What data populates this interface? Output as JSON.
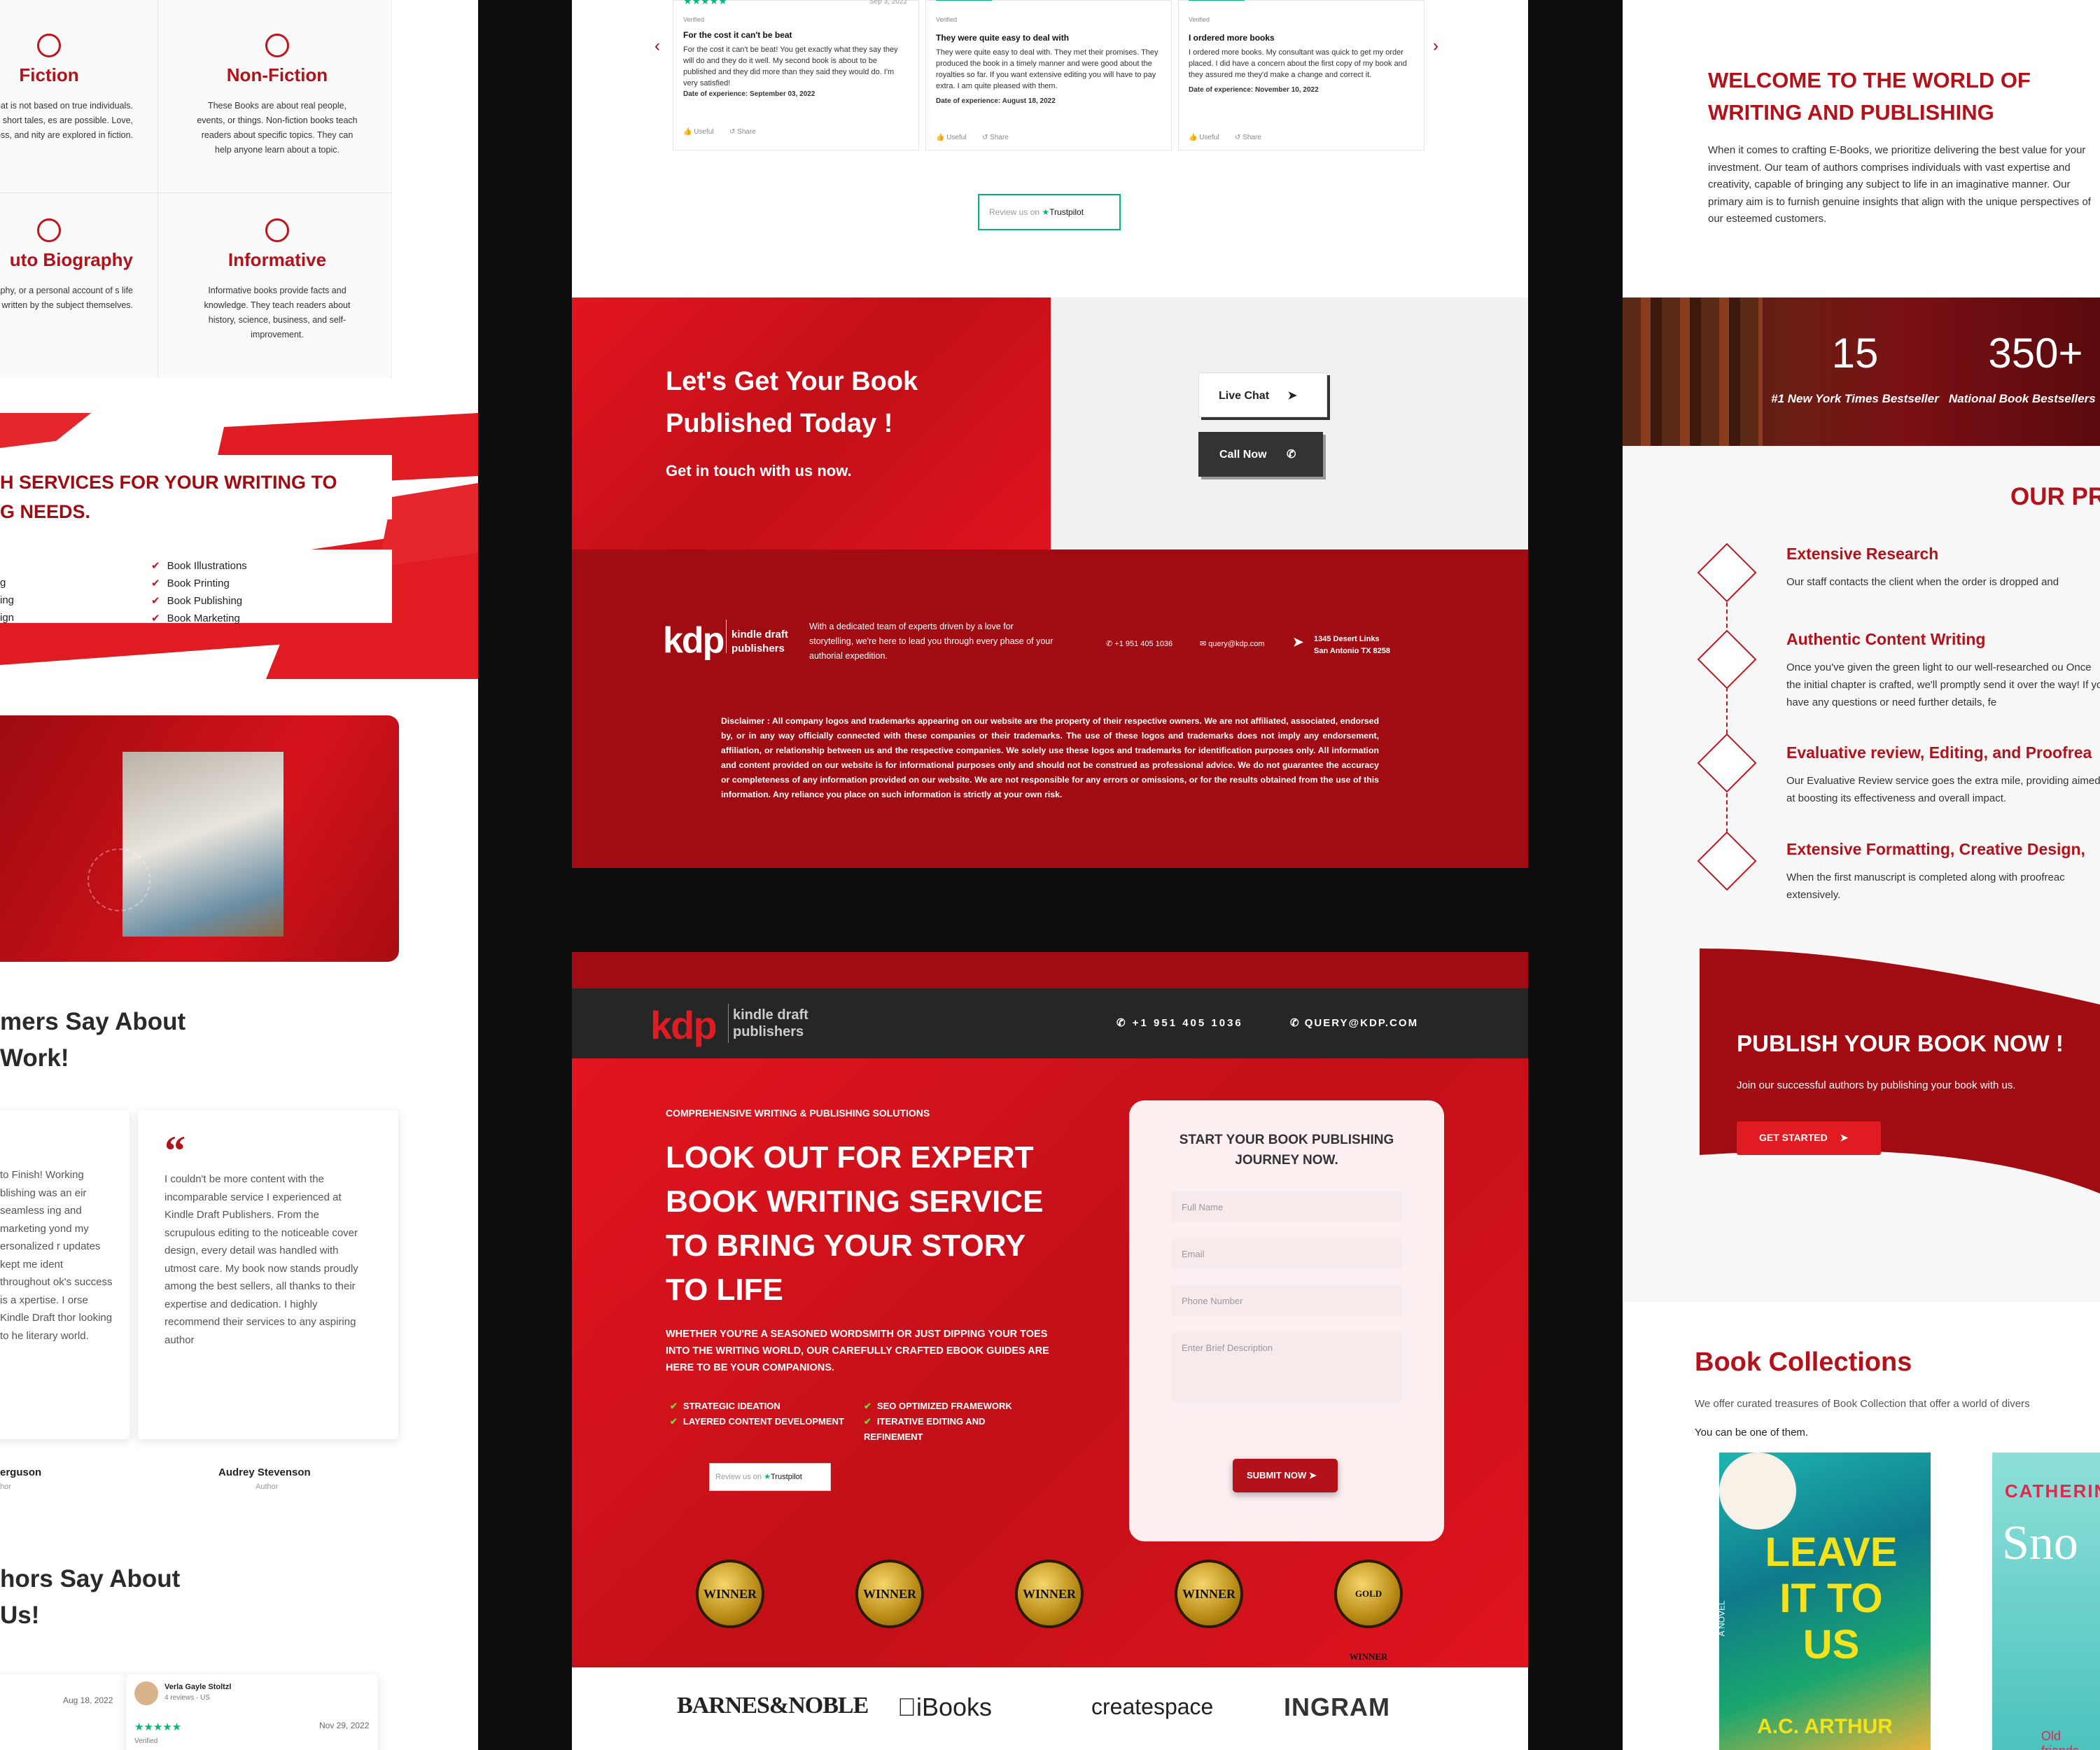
{
  "left": {
    "genres": [
      {
        "title": "Fiction",
        "text": "work that is not based on true individuals. Novels, short tales, es are possible. Love, loss, and nity are explored in fiction."
      },
      {
        "title": "Non-Fiction",
        "text": "These Books are about real people, events, or things. Non-fiction books teach readers about specific topics. They can help anyone learn about a topic."
      },
      {
        "title": "uto Biography",
        "text": "raphy, or a personal account of s life written by the subject themselves."
      },
      {
        "title": "Informative",
        "text": "Informative books provide facts and knowledge. They teach readers about history, science, business, and self-improvement."
      }
    ],
    "services_heading_1": "H SERVICES FOR YOUR WRITING TO",
    "services_heading_2": "G NEEDS.",
    "services_left": [
      "g",
      "ing",
      "ign"
    ],
    "services_right": [
      "Book Illustrations",
      "Book Printing",
      "Book Publishing",
      "Book Marketing"
    ],
    "customers_heading_1": "mers Say About",
    "customers_heading_2": "Work!",
    "testimonials": [
      {
        "text": "to Finish! Working blishing was an eir seamless ing and marketing yond my ersonalized r updates kept me ident throughout ok's success is a xpertise. I orse Kindle Draft thor looking to he literary world.",
        "name": "erguson",
        "role": "hor"
      },
      {
        "text": "I couldn't be more content with the incomparable service I experienced at Kindle Draft Publishers. From the scrupulous editing to the noticeable cover design, every detail was handled with utmost care. My book now stands proudly among the best sellers, all thanks to their expertise and dedication. I highly recommend their services to any aspiring author",
        "name": "Audrey Stevenson",
        "role": "Author"
      }
    ],
    "authors_heading_1": "hors Say About",
    "authors_heading_2": "Us!",
    "tp_review": {
      "name": "Verla Gayle Stoltzl",
      "meta": "4 reviews · US",
      "date_left": "Aug 18, 2022",
      "date_right": "Nov 29, 2022",
      "verified": "Verified"
    }
  },
  "center": {
    "reviews": [
      {
        "date": "Sep 3, 2022",
        "verified": "Verified",
        "title": "For the cost it can't be beat",
        "text": "For the cost it can't be beat! You get exactly what they say they will do and they do it well. My second book is about to be published and they did more than they said they would do. I'm very satisfied!",
        "experience": "Date of experience: September 03, 2022"
      },
      {
        "verified": "Verified",
        "title": "They were quite easy to deal with",
        "text": "They were quite easy to deal with. They met their promises. They produced the book in a timely manner and were good about the royalties so far. If you want extensive editing you will have to pay extra. I am quite pleased with them.",
        "experience": "Date of experience: August 18, 2022"
      },
      {
        "verified": "Verified",
        "title": "I ordered more books",
        "text": "I ordered more books. My consultant was quick to get my order placed. I did have a concern about the first copy of my book and they assured me they'd make a change and correct it.",
        "experience": "Date of experience: November 10, 2022"
      }
    ],
    "useful": "Useful",
    "share": "Share",
    "review_us": "Review us on",
    "trustpilot": "Trustpilot",
    "cta_title_1": "Let's Get Your Book",
    "cta_title_2": "Published Today !",
    "cta_sub": "Get in touch with us now.",
    "live_chat": "Live Chat",
    "call_now": "Call Now",
    "brand": {
      "logo": "kdp",
      "name_1": "kindle draft",
      "name_2": "publishers"
    },
    "footer_about": "With a dedicated team of experts driven by a love for storytelling, we're here to lead you through every phase of your authorial expedition.",
    "footer_phone": "+1 951 405 1036",
    "footer_email": "query@kdp.com",
    "footer_addr_1": "1345 Desert Links",
    "footer_addr_2": "San Antonio TX 8258",
    "disclaimer_label": "Disclaimer :",
    "disclaimer": "All company logos and trademarks appearing on our website are the property of their respective owners. We are not affiliated, associated, endorsed by, or in any way officially connected with these companies or their trademarks. The use of these logos and trademarks does not imply any endorsement, affiliation, or relationship between us and the respective companies. We solely use these logos and trademarks for identification purposes only. All information and content provided on our website is for informational purposes only and should not be construed as professional advice. We do not guarantee the accuracy or completeness of any information provided on our website. We are not responsible for any errors or omissions, or for the results obtained from the use of this information. Any reliance you place on such information is strictly at your own risk.",
    "header_phone": "+1 951 405 1036",
    "header_email": "QUERY@KDP.COM",
    "hero_kicker": "COMPREHENSIVE WRITING & PUBLISHING SOLUTIONS",
    "hero_title": [
      "LOOK OUT FOR EXPERT",
      "BOOK WRITING SERVICE",
      "TO BRING YOUR STORY",
      "TO LIFE"
    ],
    "hero_sub": "WHETHER YOU'RE A SEASONED WORDSMITH OR JUST DIPPING YOUR TOES INTO THE WRITING WORLD, OUR CAREFULLY CRAFTED EBOOK GUIDES ARE HERE TO BE YOUR COMPANIONS.",
    "hero_points": [
      "STRATEGIC IDEATION",
      "LAYERED CONTENT DEVELOPMENT",
      "SEO OPTIMIZED FRAMEWORK",
      "ITERATIVE EDITING AND REFINEMENT"
    ],
    "form_title": "START YOUR BOOK PUBLISHING JOURNEY NOW.",
    "form": {
      "name": "Full Name",
      "email": "Email",
      "phone": "Phone Number",
      "desc": "Enter Brief Description",
      "submit": "SUBMIT NOW"
    },
    "awards": [
      "WINNER",
      "WINNER",
      "WINNER",
      "WINNER",
      "GOLD WINNER"
    ],
    "partners": [
      "BARNES&NOBLE",
      "iBooks",
      "createspace",
      "INGRAM"
    ]
  },
  "right": {
    "welcome_1": "WELCOME TO THE WORLD OF",
    "welcome_2": "WRITING AND PUBLISHING",
    "welcome_text": "When it comes to crafting E-Books, we prioritize delivering the best value for your investment. Our team of authors comprises individuals with vast expertise and creativity, capable of bringing any subject to life in an imaginative manner. Our primary aim is to furnish genuine insights that align with the unique perspectives of our esteemed customers.",
    "stats": [
      {
        "value": "15",
        "label": "#1 New York Times Bestseller"
      },
      {
        "value": "350+",
        "label": "National Book Bestsellers"
      }
    ],
    "process_heading": "OUR PR",
    "process": [
      {
        "title": "Extensive Research",
        "text": "Our staff contacts the client when the order is dropped and"
      },
      {
        "title": "Authentic Content Writing",
        "text": "Once you've given the green light to our well-researched ou Once the initial chapter is crafted, we'll promptly send it over the way! If you have any questions or need further details, fe"
      },
      {
        "title": "Evaluative review, Editing, and Proofrea",
        "text": "Our Evaluative Review service goes the extra mile, providing aimed at boosting its effectiveness and overall impact."
      },
      {
        "title": "Extensive Formatting, Creative Design,",
        "text": "When the first manuscript is completed along with proofreac extensively."
      }
    ],
    "publish_title": "PUBLISH YOUR BOOK NOW !",
    "publish_sub": "Join our successful authors by publishing your book with us.",
    "get_started": "GET STARTED",
    "collections_title": "Book Collections",
    "collections_text": "We offer curated treasures of Book Collection that offer a world of divers",
    "collections_text_2": "You can be one of them.",
    "book1": {
      "title": "LEAVE IT TO US",
      "author": "A.C. ARTHUR",
      "spine": "A NOVEL"
    },
    "book2": {
      "author": "CATHERIN",
      "title": "Sno",
      "tag": "Old friends."
    }
  },
  "colors": {
    "brand_red": "#c0151d",
    "dark_red": "#a10c12",
    "dark": "#2a2a2a"
  }
}
